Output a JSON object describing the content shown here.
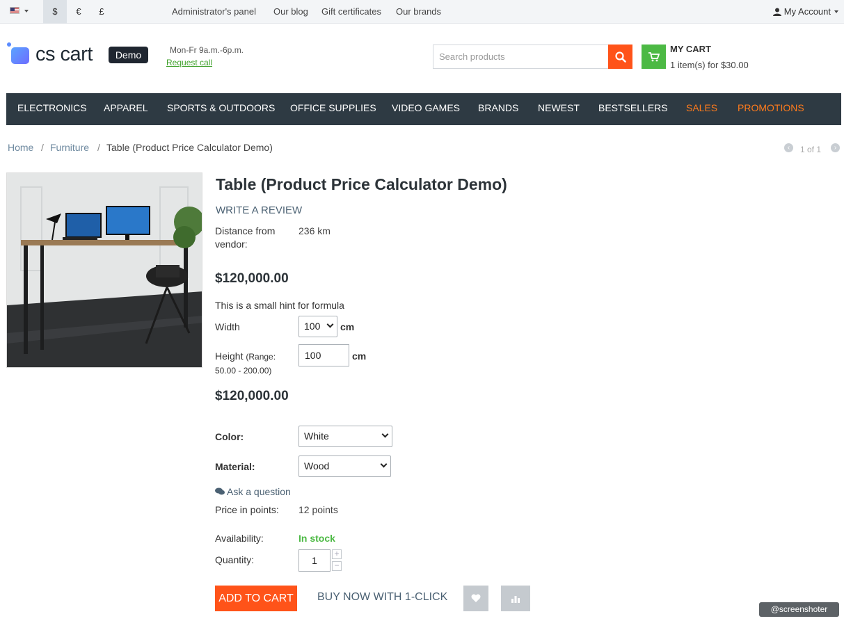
{
  "topbar": {
    "language_icon": "us-flag-icon",
    "currencies": [
      "$",
      "€",
      "£"
    ],
    "links": [
      "Administrator's panel",
      "Our blog",
      "Gift certificates",
      "Our brands"
    ],
    "account_label": "My Account"
  },
  "header": {
    "logo_text": "cs cart",
    "logo_badge": "Demo",
    "hours": "Mon-Fr 9a.m.-6p.m.",
    "request_call": "Request call",
    "search_placeholder": "Search products",
    "cart_title": "MY CART",
    "cart_summary": "1 item(s) for $30.00"
  },
  "nav": {
    "items": [
      "Electronics",
      "Apparel",
      "Sports & Outdoors",
      "Office Supplies",
      "Video Games",
      "Brands",
      "Newest",
      "Bestsellers",
      "Sales",
      "Promotions"
    ],
    "highlight_color": "#ff7b1c"
  },
  "breadcrumbs": [
    "Home",
    "Furniture",
    "Table (Product Price Calculator Demo)"
  ],
  "pager": {
    "text": "1 of 1"
  },
  "product": {
    "title": "Table (Product Price Calculator Demo)",
    "write_review": "Write a review",
    "distance_label": "Distance from vendor:",
    "distance_value": "236 km",
    "price": "$120,000.00",
    "hint": "This is a small hint for formula",
    "width_label": "Width",
    "width_value": "100",
    "width_unit": "cm",
    "height_label": "Height",
    "height_range": "(Range: 50.00 - 200.00)",
    "height_value": "100",
    "height_unit": "cm",
    "price_total": "$120,000.00",
    "color_label": "Color:",
    "color_value": "White",
    "material_label": "Material:",
    "material_value": "Wood",
    "ask_question": "Ask a question",
    "points_label": "Price in points:",
    "points_value": "12 points",
    "availability_label": "Availability:",
    "availability_value": "In stock",
    "quantity_label": "Quantity:",
    "quantity_value": "1",
    "add_to_cart": "Add to cart",
    "buy_now": "Buy now with 1-click"
  },
  "colors": {
    "accent_orange": "#ff5319",
    "cart_green": "#4cb944",
    "nav_bg": "#2e3a43"
  },
  "watermark": "@screenshoter"
}
